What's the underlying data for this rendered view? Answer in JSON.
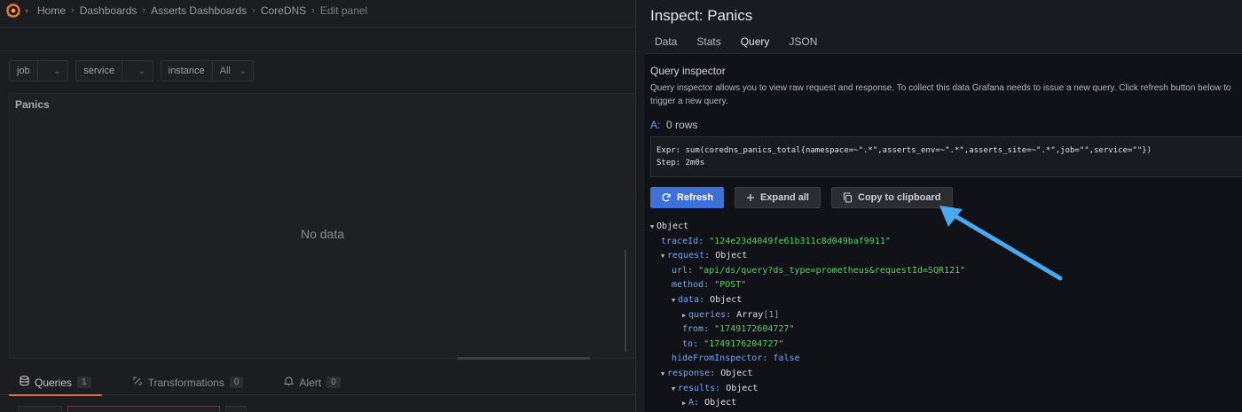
{
  "breadcrumbs": [
    "Home",
    "Dashboards",
    "Asserts Dashboards",
    "CoreDNS",
    "Edit panel"
  ],
  "variables": [
    {
      "label": "job",
      "value": ""
    },
    {
      "label": "service",
      "value": ""
    },
    {
      "label": "instance",
      "value": "All"
    }
  ],
  "panel": {
    "title": "Panics",
    "empty_text": "No data"
  },
  "bottom_tabs": [
    {
      "label": "Queries",
      "count": "1"
    },
    {
      "label": "Transformations",
      "count": "0"
    },
    {
      "label": "Alert",
      "count": "0"
    }
  ],
  "drawer": {
    "title": "Inspect: Panics",
    "tabs": [
      "Data",
      "Stats",
      "Query",
      "JSON"
    ],
    "active_tab": "Query",
    "inspector_title": "Query inspector",
    "inspector_desc": "Query inspector allows you to view raw request and response. To collect this data Grafana needs to issue a new query. Click refresh button below to trigger a new query.",
    "query_letter": "A:",
    "rows_text": "0 rows",
    "expr_line": "Expr: sum(coredns_panics_total{namespace=~\".*\",asserts_env=~\".*\",asserts_site=~\".*\",job=\"\",service=\"\"})",
    "step_line": "Step: 2m0s",
    "buttons": {
      "refresh": "Refresh",
      "expand": "Expand all",
      "copy": "Copy to clipboard"
    }
  },
  "tree": {
    "root": "Object",
    "trace_key": "traceId:",
    "trace_val": "\"124e23d4049fe61b311c8d049baf9911\"",
    "request_key": "request:",
    "request_type": "Object",
    "url_key": "url:",
    "url_val": "\"api/ds/query?ds_type=prometheus&requestId=SQR121\"",
    "method_key": "method:",
    "method_val": "\"POST\"",
    "data_key": "data:",
    "data_type": "Object",
    "queries_key": "queries:",
    "queries_type": "Array",
    "queries_len": "[1]",
    "from_key": "from:",
    "from_val": "\"1749172604727\"",
    "to_key": "to:",
    "to_val": "\"1749176204727\"",
    "hide_key": "hideFromInspector:",
    "hide_val": "false",
    "response_key": "response:",
    "response_type": "Object",
    "results_key": "results:",
    "results_type": "Object",
    "a_key": "A:",
    "a_type": "Object"
  },
  "colors": {
    "accent": "#3d71d9",
    "tab_active": "#f08a3c",
    "string": "#5fd068",
    "key": "#74a6ee",
    "arrow": "#4aa8f0"
  }
}
